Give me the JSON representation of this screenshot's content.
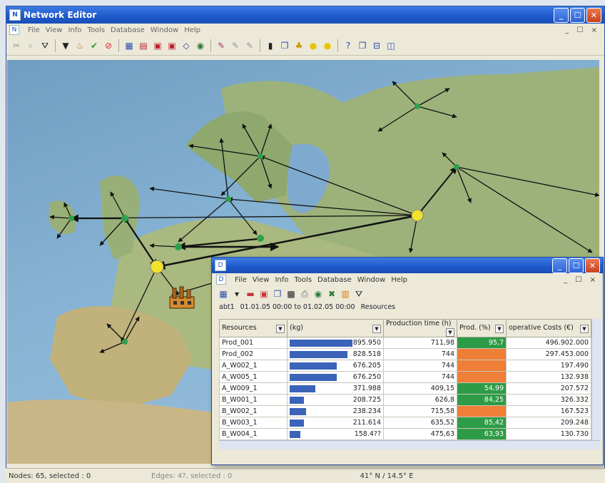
{
  "app": {
    "title": "Network Editor"
  },
  "menu": [
    "File",
    "View",
    "Info",
    "Tools",
    "Database",
    "Window",
    "Help"
  ],
  "mdi_controls": "_ ☐ ×",
  "status": {
    "nodes": "Nodes: 65, selected : 0",
    "edges": "Edges: 4?, selected : 0",
    "coords": "41° N  /  14.5° E"
  },
  "inner": {
    "menu": [
      "File",
      "View",
      "Info",
      "Tools",
      "Database",
      "Window",
      "Help"
    ],
    "info": {
      "id": "abt1",
      "range": "01.01.05 00:00  to 01.02.05 00:00",
      "label": "Resources"
    },
    "columns": [
      "Resources",
      "(kg)",
      "Production time (h)",
      "Prod. (%)",
      "operative Costs  (€)"
    ],
    "rows": [
      {
        "name": "Prod_001",
        "kg": "895.950",
        "kg_frac": 1.0,
        "time": "711,98",
        "prod": "95,7",
        "prod_color": "g",
        "cost": "496.902.000"
      },
      {
        "name": "Prod_002",
        "kg": "828.518",
        "kg_frac": 0.92,
        "time": "744",
        "prod": "",
        "prod_color": "o",
        "cost": "297.453.000"
      },
      {
        "name": "A_W002_1",
        "kg": "676.205",
        "kg_frac": 0.75,
        "time": "744",
        "prod": "",
        "prod_color": "o",
        "cost": "197.490"
      },
      {
        "name": "A_W005_1",
        "kg": "676.250",
        "kg_frac": 0.75,
        "time": "744",
        "prod": "",
        "prod_color": "o",
        "cost": "132.938"
      },
      {
        "name": "A_W009_1",
        "kg": "371.988",
        "kg_frac": 0.41,
        "time": "409,15",
        "prod": "54,99",
        "prod_color": "g",
        "cost": "207.572"
      },
      {
        "name": "B_W001_1",
        "kg": "208.725",
        "kg_frac": 0.23,
        "time": "626,8",
        "prod": "84,25",
        "prod_color": "g",
        "cost": "326.332"
      },
      {
        "name": "B_W002_1",
        "kg": "238.234",
        "kg_frac": 0.26,
        "time": "715,58",
        "prod": "",
        "prod_color": "o",
        "cost": "167.523"
      },
      {
        "name": "B_W003_1",
        "kg": "211.614",
        "kg_frac": 0.23,
        "time": "635,52",
        "prod": "85,42",
        "prod_color": "g",
        "cost": "209.248"
      },
      {
        "name": "B_W004_1",
        "kg": "158.4??",
        "kg_frac": 0.17,
        "time": "475,63",
        "prod": "63,93",
        "prod_color": "g",
        "cost": "130.730"
      }
    ]
  },
  "colors": {
    "title_blue": "#1d57c9",
    "bar": "#3a63b9",
    "green": "#2e9b46",
    "orange": "#ef7e36",
    "node_green": "#2fa04a",
    "node_yellow": "#f2e22a"
  },
  "icons": [
    "cut-icon",
    "filter-icon",
    "fire-icon",
    "check-icon",
    "cancel-icon",
    "table-icon",
    "chart-icon",
    "diamond-icon",
    "globe-icon",
    "pencil-icon",
    "bulb-icon",
    "help-icon",
    "window-icon"
  ]
}
